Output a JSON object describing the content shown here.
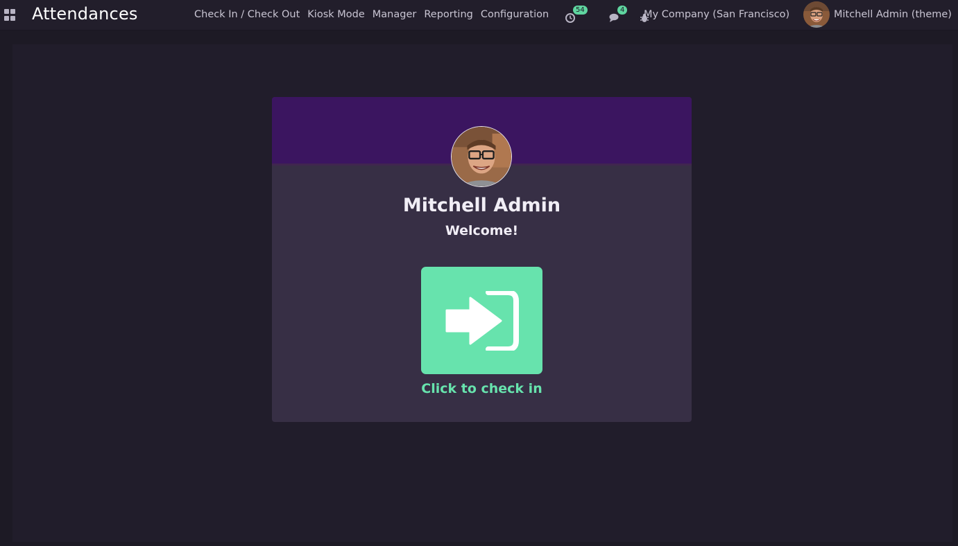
{
  "header": {
    "app_title": "Attendances",
    "menu": [
      "Check In / Check Out",
      "Kiosk Mode",
      "Manager",
      "Reporting",
      "Configuration"
    ],
    "activities_badge": "54",
    "messages_badge": "4",
    "company": "My Company (San Francisco)",
    "user": "Mitchell Admin (theme)"
  },
  "card": {
    "employee_name": "Mitchell Admin",
    "greeting": "Welcome!",
    "action_label": "Click to check in"
  },
  "colors": {
    "accent": "#67e3ad",
    "header_band": "#3b1560",
    "card_bg": "#372f45",
    "page_bg": "#211d2b"
  },
  "icons": [
    "apps-grid-icon",
    "clock-icon",
    "chat-icon",
    "bug-icon",
    "sign-in-icon"
  ]
}
